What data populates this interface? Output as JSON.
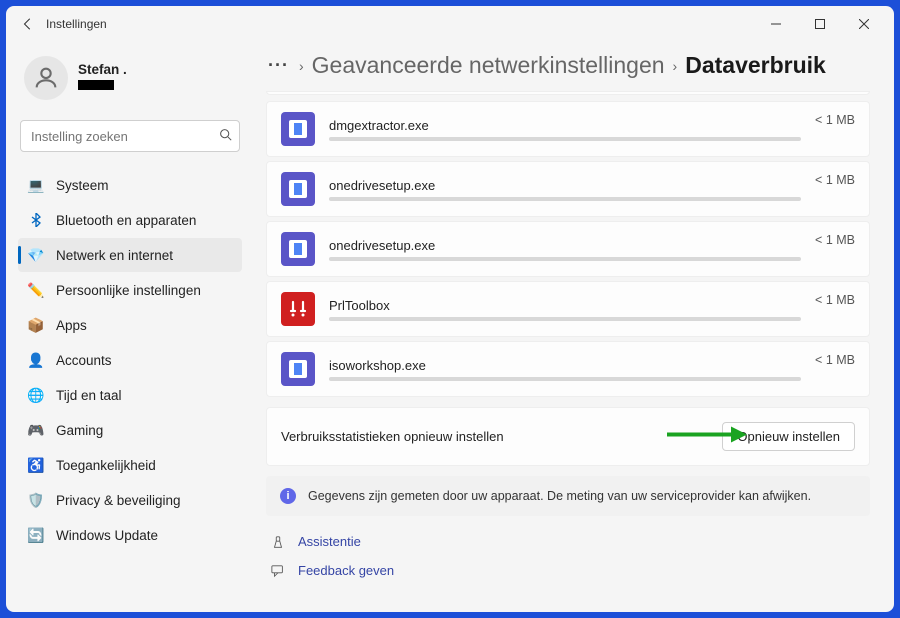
{
  "window": {
    "title": "Instellingen"
  },
  "profile": {
    "name": "Stefan ."
  },
  "search": {
    "placeholder": "Instelling zoeken"
  },
  "sidebar": {
    "items": [
      {
        "label": "Systeem",
        "icon": "💻"
      },
      {
        "label": "Bluetooth en apparaten",
        "icon": "bt"
      },
      {
        "label": "Netwerk en internet",
        "icon": "💎",
        "active": true
      },
      {
        "label": "Persoonlijke instellingen",
        "icon": "✏️"
      },
      {
        "label": "Apps",
        "icon": "📦"
      },
      {
        "label": "Accounts",
        "icon": "👤"
      },
      {
        "label": "Tijd en taal",
        "icon": "🌐"
      },
      {
        "label": "Gaming",
        "icon": "🎮"
      },
      {
        "label": "Toegankelijkheid",
        "icon": "♿"
      },
      {
        "label": "Privacy & beveiliging",
        "icon": "🛡️"
      },
      {
        "label": "Windows Update",
        "icon": "🔄"
      }
    ]
  },
  "breadcrumb": {
    "parent": "Geavanceerde netwerkinstellingen",
    "current": "Dataverbruik"
  },
  "apps": [
    {
      "name": "dmgextractor.exe",
      "size": "< 1 MB",
      "iconType": "blue"
    },
    {
      "name": "onedrivesetup.exe",
      "size": "< 1 MB",
      "iconType": "blue"
    },
    {
      "name": "onedrivesetup.exe",
      "size": "< 1 MB",
      "iconType": "blue"
    },
    {
      "name": "PrlToolbox",
      "size": "< 1 MB",
      "iconType": "red"
    },
    {
      "name": "isoworkshop.exe",
      "size": "< 1 MB",
      "iconType": "blue"
    }
  ],
  "reset": {
    "label": "Verbruiksstatistieken opnieuw instellen",
    "button": "Opnieuw instellen"
  },
  "banner": {
    "text": "Gegevens zijn gemeten door uw apparaat. De meting van uw serviceprovider kan afwijken."
  },
  "footer": {
    "help": "Assistentie",
    "feedback": "Feedback geven"
  }
}
